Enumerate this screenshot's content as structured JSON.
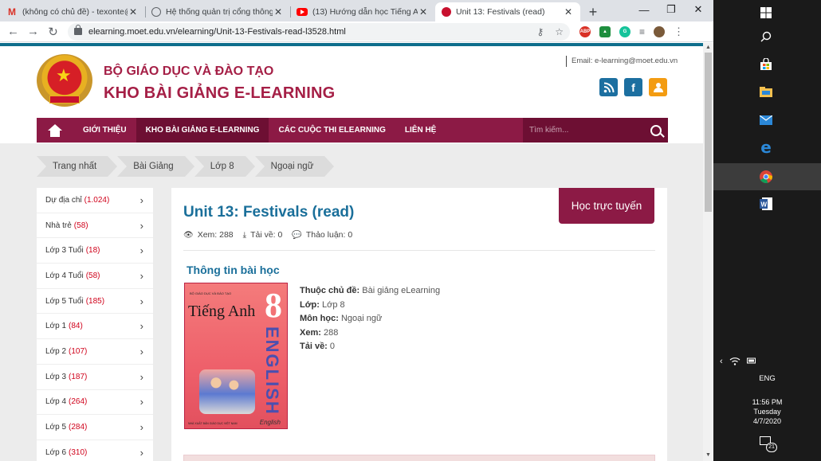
{
  "browser": {
    "tabs": [
      {
        "title": "(không có chủ đề) - texonte@gmai",
        "icon": "gmail-icon"
      },
      {
        "title": "Hệ thống quản trị cổng thông tin",
        "icon": "globe-icon"
      },
      {
        "title": "(13) Hướng dẫn học Tiếng Anh lớ",
        "icon": "youtube-icon"
      },
      {
        "title": "Unit 13: Festivals (read)",
        "icon": "emblem-icon"
      }
    ],
    "url": "elearning.moet.edu.vn/elearning/Unit-13-Festivals-read-l3528.html"
  },
  "header": {
    "org": "BỘ GIÁO DỤC VÀ ĐÀO TẠO",
    "site": "KHO BÀI GIẢNG E-LEARNING",
    "email": "Email: e-learning@moet.edu.vn"
  },
  "nav": {
    "items": [
      "GIỚI THIỆU",
      "KHO BÀI GIẢNG E-LEARNING",
      "CÁC CUỘC THI ELEARNING",
      "LIÊN HỆ"
    ],
    "search_placeholder": "Tìm kiếm..."
  },
  "breadcrumb": [
    "Trang nhất",
    "Bài Giảng",
    "Lớp 8",
    "Ngoại ngữ"
  ],
  "sidebar": [
    {
      "label": "Dự địa chỉ",
      "count": "(1.024)"
    },
    {
      "label": "Nhà trẻ",
      "count": "(58)"
    },
    {
      "label": "Lớp 3 Tuổi",
      "count": "(18)"
    },
    {
      "label": "Lớp 4 Tuổi",
      "count": "(58)"
    },
    {
      "label": "Lớp 5 Tuổi",
      "count": "(185)"
    },
    {
      "label": "Lớp 1",
      "count": "(84)"
    },
    {
      "label": "Lớp 2",
      "count": "(107)"
    },
    {
      "label": "Lớp 3",
      "count": "(187)"
    },
    {
      "label": "Lớp 4",
      "count": "(264)"
    },
    {
      "label": "Lớp 5",
      "count": "(284)"
    },
    {
      "label": "Lớp 6",
      "count": "(310)"
    }
  ],
  "lesson": {
    "title": "Unit 13: Festivals (read)",
    "learn_button": "Học trực tuyến",
    "views": "Xem: 288",
    "downloads": "Tải về: 0",
    "comments": "Thảo luận: 0",
    "info_heading": "Thông tin bài học",
    "meta": [
      {
        "label": "Thuộc chủ đề:",
        "value": "Bài giảng eLearning"
      },
      {
        "label": "Lớp:",
        "value": "Lớp 8"
      },
      {
        "label": "Môn học:",
        "value": "Ngoại ngữ"
      },
      {
        "label": "Xem:",
        "value": "288"
      },
      {
        "label": "Tải về:",
        "value": "0"
      }
    ]
  },
  "book_cover": {
    "publisher_top": "BỘ GIÁO DỤC VÀ ĐÀO TẠO",
    "title": "Tiếng Anh",
    "number": "8",
    "vertical": "ENGLISH",
    "subtitle": "English",
    "publisher_bottom": "NHÀ XUẤT BẢN GIÁO DỤC VIỆT NAM"
  },
  "taskbar": {
    "language": "ENG",
    "time": "11:56 PM",
    "day": "Tuesday",
    "date": "4/7/2020",
    "notifications": "21"
  },
  "colors": {
    "brand": "#8c1a45",
    "title_blue": "#1a6f9a",
    "count_red": "#d0021b",
    "rss": "#1c6fa0",
    "facebook": "#1c6fa0",
    "blogger": "#f39c12"
  }
}
